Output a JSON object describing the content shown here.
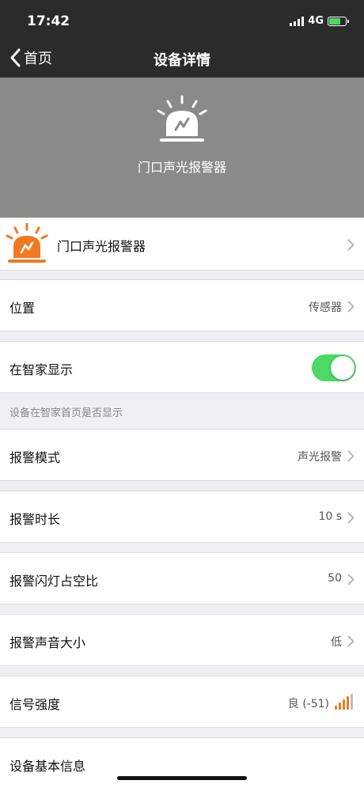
{
  "status_bar": {
    "time": "17:42",
    "network": "4G"
  },
  "nav": {
    "back_label": "首页",
    "title": "设备详情"
  },
  "hero": {
    "device_name": "门口声光报警器"
  },
  "device_row": {
    "name": "门口声光报警器"
  },
  "rows": {
    "location": {
      "label": "位置",
      "value": "传感器"
    },
    "show_home": {
      "label": "在智家显示",
      "toggle_on": true
    },
    "hint": "设备在智家首页是否显示",
    "alarm_mode": {
      "label": "报警模式",
      "value": "声光报警"
    },
    "alarm_duration": {
      "label": "报警时长",
      "value": "10 s"
    },
    "flash_duty": {
      "label": "报警闪灯占空比",
      "value": "50"
    },
    "alarm_volume": {
      "label": "报警声音大小",
      "value": "低"
    },
    "signal": {
      "label": "信号强度",
      "value": "良 (-51)"
    },
    "basic_info": {
      "label": "设备基本信息"
    }
  },
  "colors": {
    "accent_green": "#4cd964",
    "brand_orange": "#f07a22",
    "nav_bg": "#2b2b2b",
    "hero_bg": "#8a8a8a"
  }
}
